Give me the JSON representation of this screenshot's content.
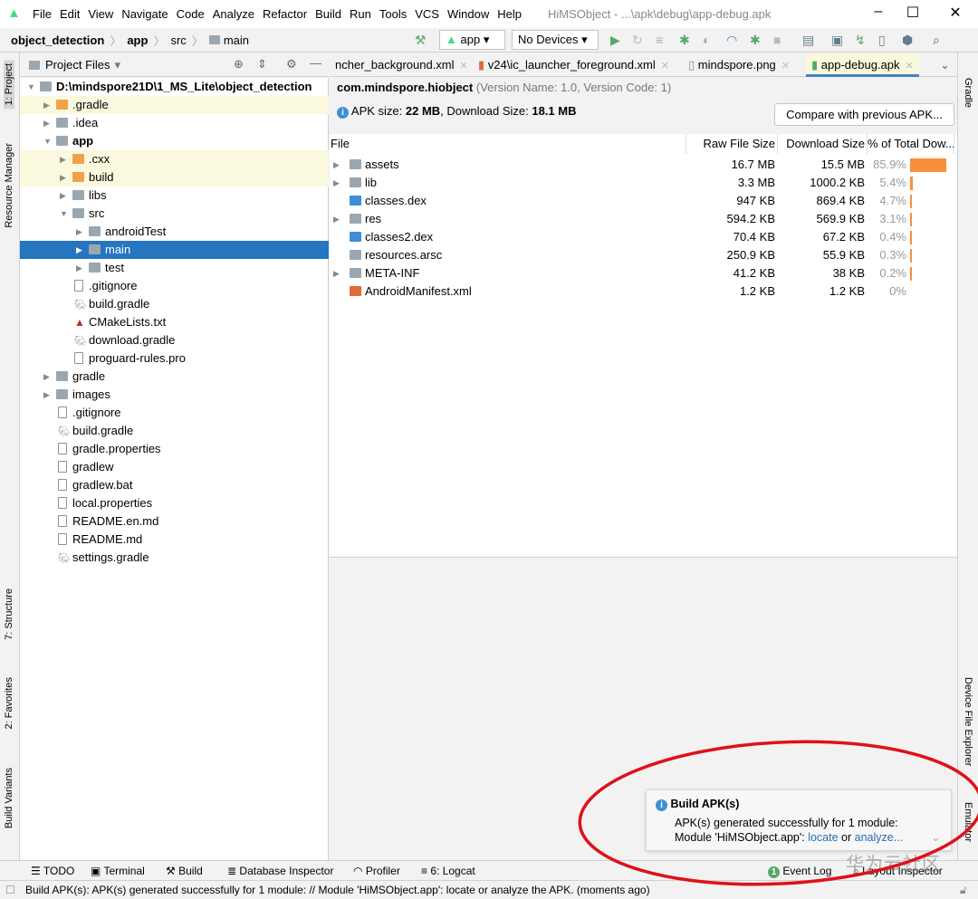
{
  "titlebar": {
    "menu": [
      "File",
      "Edit",
      "View",
      "Navigate",
      "Code",
      "Analyze",
      "Refactor",
      "Build",
      "Run",
      "Tools",
      "VCS",
      "Window",
      "Help"
    ],
    "title": "HiMSObject - ...\\apk\\debug\\app-debug.apk",
    "minimize": "–",
    "maximize": "☐",
    "close": "✕"
  },
  "navbar": {
    "breadcrumbs": [
      "object_detection",
      "app",
      "src",
      "main"
    ],
    "run_config": "app",
    "device": "No Devices"
  },
  "left_strip": {
    "project": "1: Project",
    "resource_manager": "Resource Manager",
    "structure": "7: Structure",
    "favorites": "2: Favorites",
    "build_variants": "Build Variants"
  },
  "right_strip": {
    "gradle": "Gradle",
    "device_file_explorer": "Device File Explorer",
    "emulator": "Emulator"
  },
  "project_panel": {
    "view": "Project Files",
    "tree": [
      {
        "label": "D:\\mindspore21D\\1_MS_Lite\\object_detection",
        "level": 0,
        "arrow": "down",
        "bold": true,
        "icon": "folder"
      },
      {
        "label": ".gradle",
        "level": 1,
        "arrow": "right",
        "icon": "folder-orange",
        "hl": true
      },
      {
        "label": ".idea",
        "level": 1,
        "arrow": "right",
        "icon": "folder"
      },
      {
        "label": "app",
        "level": 1,
        "arrow": "down",
        "bold": true,
        "icon": "module"
      },
      {
        "label": ".cxx",
        "level": 2,
        "arrow": "right",
        "icon": "folder-orange",
        "hl": true
      },
      {
        "label": "build",
        "level": 2,
        "arrow": "right",
        "icon": "folder-orange",
        "hl": true
      },
      {
        "label": "libs",
        "level": 2,
        "arrow": "right",
        "icon": "folder"
      },
      {
        "label": "src",
        "level": 2,
        "arrow": "down",
        "icon": "folder"
      },
      {
        "label": "androidTest",
        "level": 3,
        "arrow": "right",
        "icon": "folder"
      },
      {
        "label": "main",
        "level": 3,
        "arrow": "right",
        "icon": "folder",
        "selected": true
      },
      {
        "label": "test",
        "level": 3,
        "arrow": "right",
        "icon": "folder"
      },
      {
        "label": ".gitignore",
        "level": 2,
        "icon": "file"
      },
      {
        "label": "build.gradle",
        "level": 2,
        "icon": "gradle"
      },
      {
        "label": "CMakeLists.txt",
        "level": 2,
        "icon": "cmake"
      },
      {
        "label": "download.gradle",
        "level": 2,
        "icon": "gradle"
      },
      {
        "label": "proguard-rules.pro",
        "level": 2,
        "icon": "file"
      },
      {
        "label": "gradle",
        "level": 1,
        "arrow": "right",
        "icon": "folder"
      },
      {
        "label": "images",
        "level": 1,
        "arrow": "right",
        "icon": "folder"
      },
      {
        "label": ".gitignore",
        "level": 1,
        "icon": "file"
      },
      {
        "label": "build.gradle",
        "level": 1,
        "icon": "gradle"
      },
      {
        "label": "gradle.properties",
        "level": 1,
        "icon": "properties"
      },
      {
        "label": "gradlew",
        "level": 1,
        "icon": "file"
      },
      {
        "label": "gradlew.bat",
        "level": 1,
        "icon": "file"
      },
      {
        "label": "local.properties",
        "level": 1,
        "icon": "properties"
      },
      {
        "label": "README.en.md",
        "level": 1,
        "icon": "file"
      },
      {
        "label": "README.md",
        "level": 1,
        "icon": "file"
      },
      {
        "label": "settings.gradle",
        "level": 1,
        "icon": "gradle"
      }
    ]
  },
  "tabs": [
    {
      "label": "ncher_background.xml"
    },
    {
      "label": "v24\\ic_launcher_foreground.xml"
    },
    {
      "label": "mindspore.png"
    },
    {
      "label": "app-debug.apk",
      "active": true
    }
  ],
  "apk": {
    "package": "com.mindspore.hiobject",
    "version": "(Version Name: 1.0, Version Code: 1)",
    "size_label": "APK size: ",
    "apk_size": "22 MB",
    "dl_label": ", Download Size: ",
    "dl_size": "18.1 MB",
    "compare_button": "Compare with previous APK...",
    "columns": [
      "File",
      "Raw File Size",
      "Download Size",
      "% of Total Dow..."
    ],
    "rows": [
      {
        "name": "assets",
        "raw": "16.7 MB",
        "download": "15.5 MB",
        "percent": "85.9%",
        "fraction": 0.859,
        "expandable": true,
        "icon": "folder"
      },
      {
        "name": "lib",
        "raw": "3.3 MB",
        "download": "1000.2 KB",
        "percent": "5.4%",
        "fraction": 0.054,
        "expandable": true,
        "icon": "folder"
      },
      {
        "name": "classes.dex",
        "raw": "947 KB",
        "download": "869.4 KB",
        "percent": "4.7%",
        "fraction": 0.047,
        "icon": "dex"
      },
      {
        "name": "res",
        "raw": "594.2 KB",
        "download": "569.9 KB",
        "percent": "3.1%",
        "fraction": 0.031,
        "expandable": true,
        "icon": "res-folder"
      },
      {
        "name": "classes2.dex",
        "raw": "70.4 KB",
        "download": "67.2 KB",
        "percent": "0.4%",
        "fraction": 0.004,
        "icon": "dex"
      },
      {
        "name": "resources.arsc",
        "raw": "250.9 KB",
        "download": "55.9 KB",
        "percent": "0.3%",
        "fraction": 0.003,
        "icon": "arsc"
      },
      {
        "name": "META-INF",
        "raw": "41.2 KB",
        "download": "38 KB",
        "percent": "0.2%",
        "fraction": 0.002,
        "expandable": true,
        "icon": "folder"
      },
      {
        "name": "AndroidManifest.xml",
        "raw": "1.2 KB",
        "download": "1.2 KB",
        "percent": "0%",
        "fraction": 0,
        "icon": "xml"
      }
    ]
  },
  "notification": {
    "title": "Build APK(s)",
    "line1": "APK(s) generated successfully for 1 module:",
    "line2_prefix": "Module 'HiMSObject.app': ",
    "locate": "locate",
    "or": " or ",
    "analyze": "analyze..."
  },
  "bottom_tools": {
    "todo": "TODO",
    "terminal": "Terminal",
    "build": "Build",
    "database": "Database Inspector",
    "profiler": "Profiler",
    "logcat": "6: Logcat",
    "event_log": "Event Log",
    "event_count": "1",
    "layout_inspector": "Layout Inspector"
  },
  "status": "Build APK(s): APK(s) generated successfully for 1 module: // Module 'HiMSObject.app': locate or analyze the APK. (moments ago)",
  "watermark": "华为云社区",
  "colors": {
    "accent": "#2675bf",
    "bar": "#f98f3a",
    "annotation": "#e0101a",
    "highlight": "#fbf9dd"
  }
}
